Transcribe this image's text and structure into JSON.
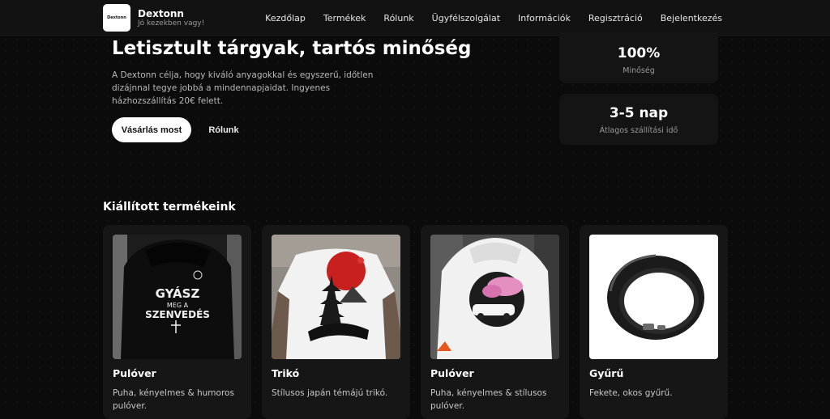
{
  "brand": {
    "logo_text": "Dextonn",
    "name": "Dextonn",
    "tagline": "Jó kezekben vagy!"
  },
  "nav": {
    "items": [
      "Kezdőlap",
      "Termékek",
      "Rólunk",
      "Ügyfélszolgálat",
      "Információk",
      "Regisztráció",
      "Bejelentkezés"
    ]
  },
  "hero": {
    "title": "Letisztult tárgyak, tartós minőség",
    "description": "A Dextonn célja, hogy kiváló anyagokkal és egyszerű, időtlen dizájnnal tegye jobbá a mindennapjaidat. Ingyenes házhozszállítás 20€ felett.",
    "primary_button": "Vásárlás most",
    "secondary_button": "Rólunk"
  },
  "stats": [
    {
      "value": "100%",
      "label": "Minőség"
    },
    {
      "value": "3-5 nap",
      "label": "Átlagos szállítási idő"
    }
  ],
  "featured": {
    "title": "Kiállított termékeink",
    "products": [
      {
        "name": "Pulóver",
        "description": "Puha, kényelmes & humoros pulóver.",
        "print_text": [
          "GYÁSZ",
          "MEG A",
          "SZENVEDÉS"
        ]
      },
      {
        "name": "Trikó",
        "description": "Stílusos japán témájú trikó."
      },
      {
        "name": "Pulóver",
        "description": "Puha, kényelmes & stílusos pulóver."
      },
      {
        "name": "Gyűrű",
        "description": "Fekete, okos gyűrű."
      }
    ]
  }
}
